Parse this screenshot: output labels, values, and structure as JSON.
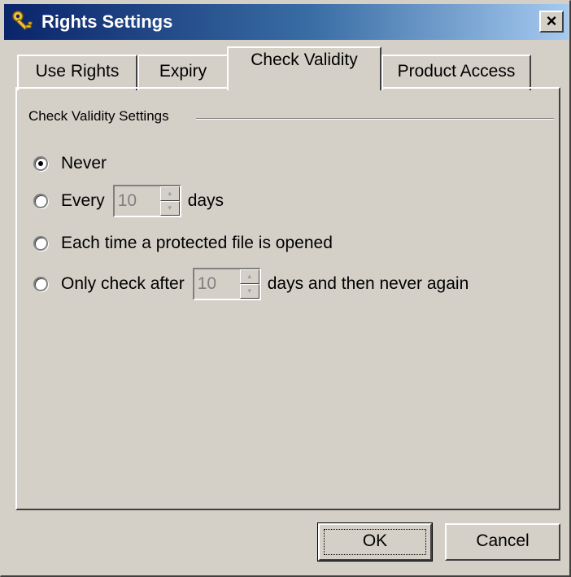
{
  "window": {
    "title": "Rights Settings",
    "close_label": "×",
    "icon": "key-icon"
  },
  "tabs": [
    {
      "label": "Use Rights",
      "active": false
    },
    {
      "label": "Expiry",
      "active": false
    },
    {
      "label": "Check Validity",
      "active": true
    },
    {
      "label": "Product Access",
      "active": false
    }
  ],
  "panel": {
    "group_title": "Check Validity Settings",
    "options": [
      {
        "label": "Never",
        "selected": true
      },
      {
        "label_before": "Every",
        "spin_value": "10",
        "label_after": "days",
        "selected": false
      },
      {
        "label": "Each time a protected file is opened",
        "selected": false
      },
      {
        "label_before": "Only check after",
        "spin_value": "10",
        "label_after": "days and then never again",
        "selected": false
      }
    ]
  },
  "buttons": {
    "ok": "OK",
    "cancel": "Cancel"
  },
  "colors": {
    "face": "#d4d0c8",
    "title_start": "#0a246a",
    "title_end": "#a6caf0",
    "disabled_text": "#808080"
  }
}
